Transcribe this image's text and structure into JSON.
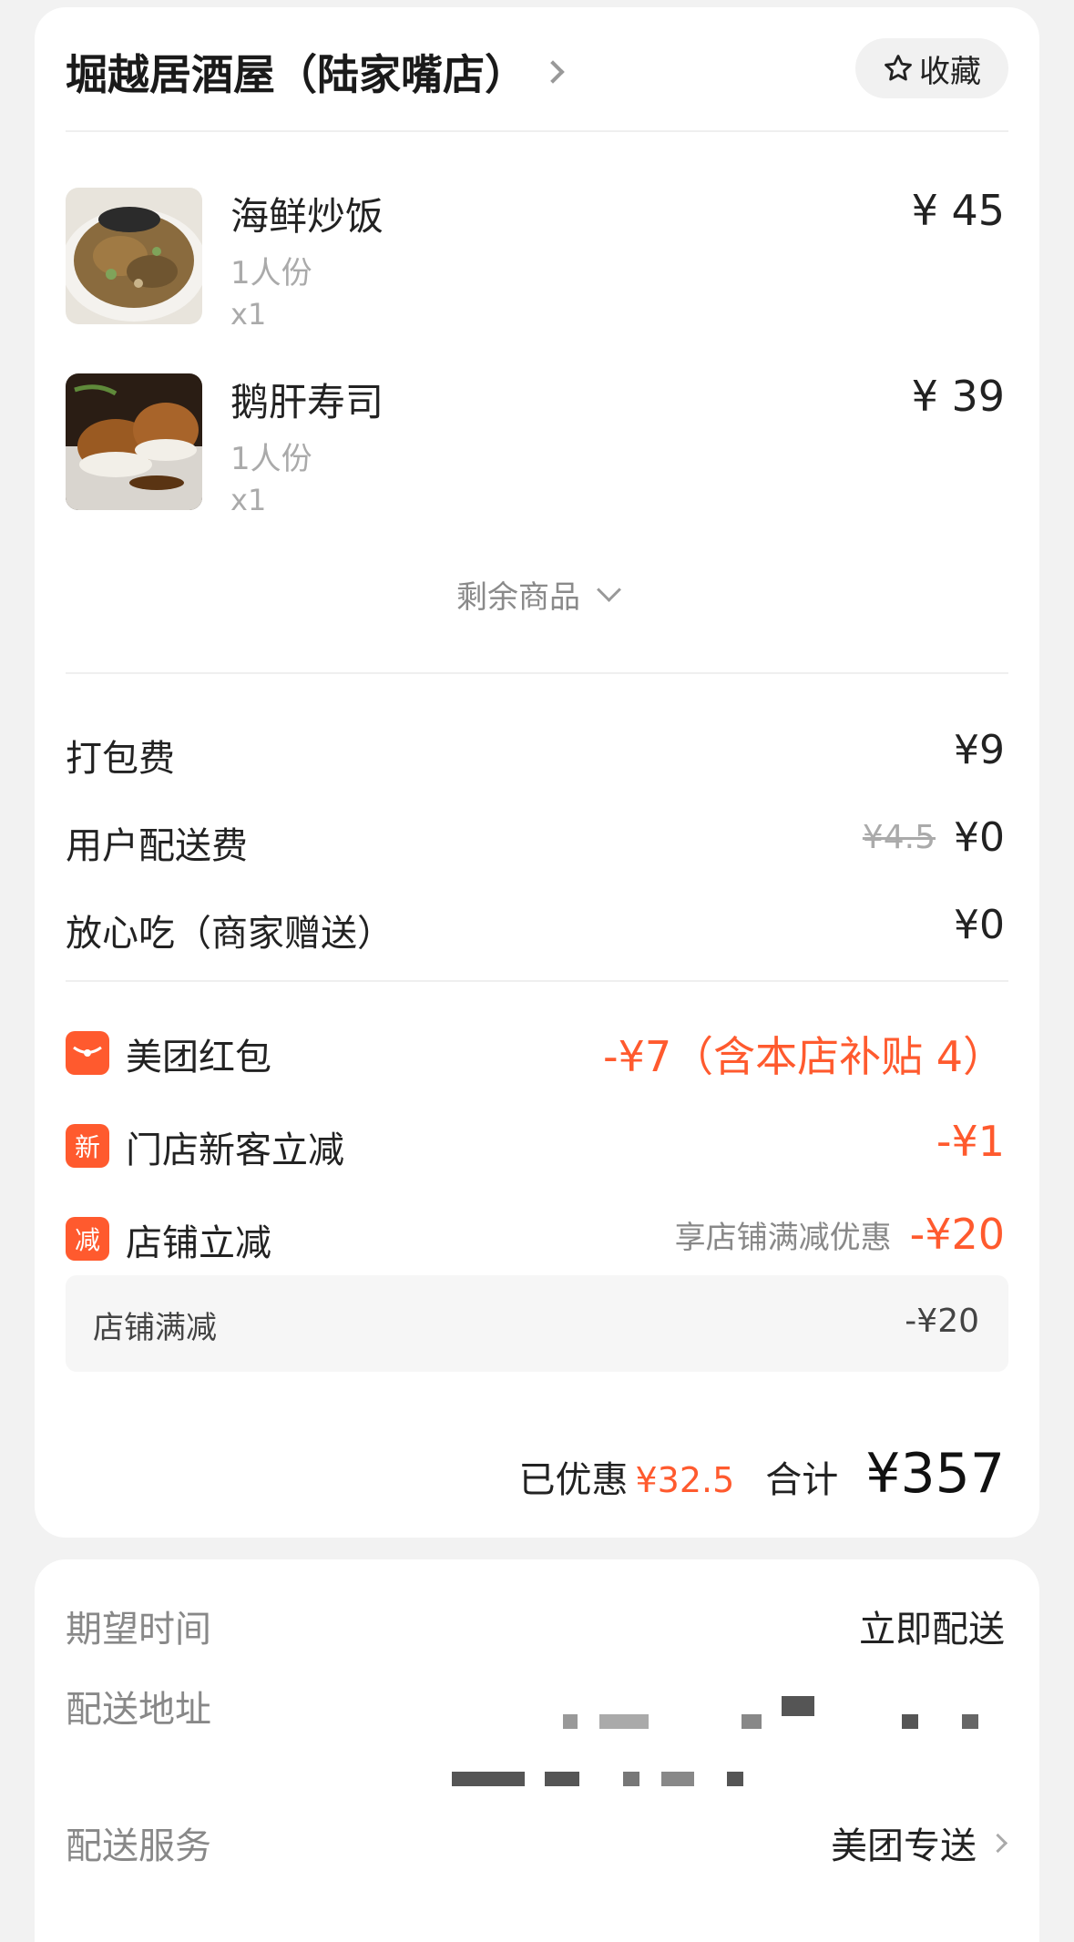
{
  "shop": {
    "name": "堀越居酒屋（陆家嘴店）",
    "favorite_label": "收藏"
  },
  "items": [
    {
      "name": "海鲜炒饭",
      "spec": "1人份",
      "qty": "x1",
      "price": "¥ 45"
    },
    {
      "name": "鹅肝寿司",
      "spec": "1人份",
      "qty": "x1",
      "price": "¥ 39"
    }
  ],
  "more_items_label": "剩余商品",
  "fees": {
    "packing": {
      "label": "打包费",
      "value": "¥9"
    },
    "delivery": {
      "label": "用户配送费",
      "original": "¥4.5",
      "value": "¥0"
    },
    "assurance": {
      "label": "放心吃（商家赠送）",
      "value": "¥0"
    }
  },
  "discounts": {
    "redpacket": {
      "icon": "wallet-icon",
      "label": "美团红包",
      "value": "-¥7（含本店补贴 4）"
    },
    "newcustomer": {
      "icon_text": "新",
      "label": "门店新客立减",
      "value": "-¥1"
    },
    "shop": {
      "icon_text": "减",
      "label": "店铺立减",
      "note": "享店铺满减优惠",
      "value": "-¥20"
    },
    "shop_detail": {
      "label": "店铺满减",
      "value": "-¥20"
    }
  },
  "summary": {
    "saved_label": "已优惠",
    "saved_value": "¥32.5",
    "total_label": "合计",
    "total_value": "¥357"
  },
  "delivery": {
    "time_label": "期望时间",
    "time_value": "立即配送",
    "address_label": "配送地址",
    "service_label": "配送服务",
    "service_value": "美团专送"
  },
  "colors": {
    "accent": "#ff5a2e",
    "background": "#f2f2f2"
  }
}
